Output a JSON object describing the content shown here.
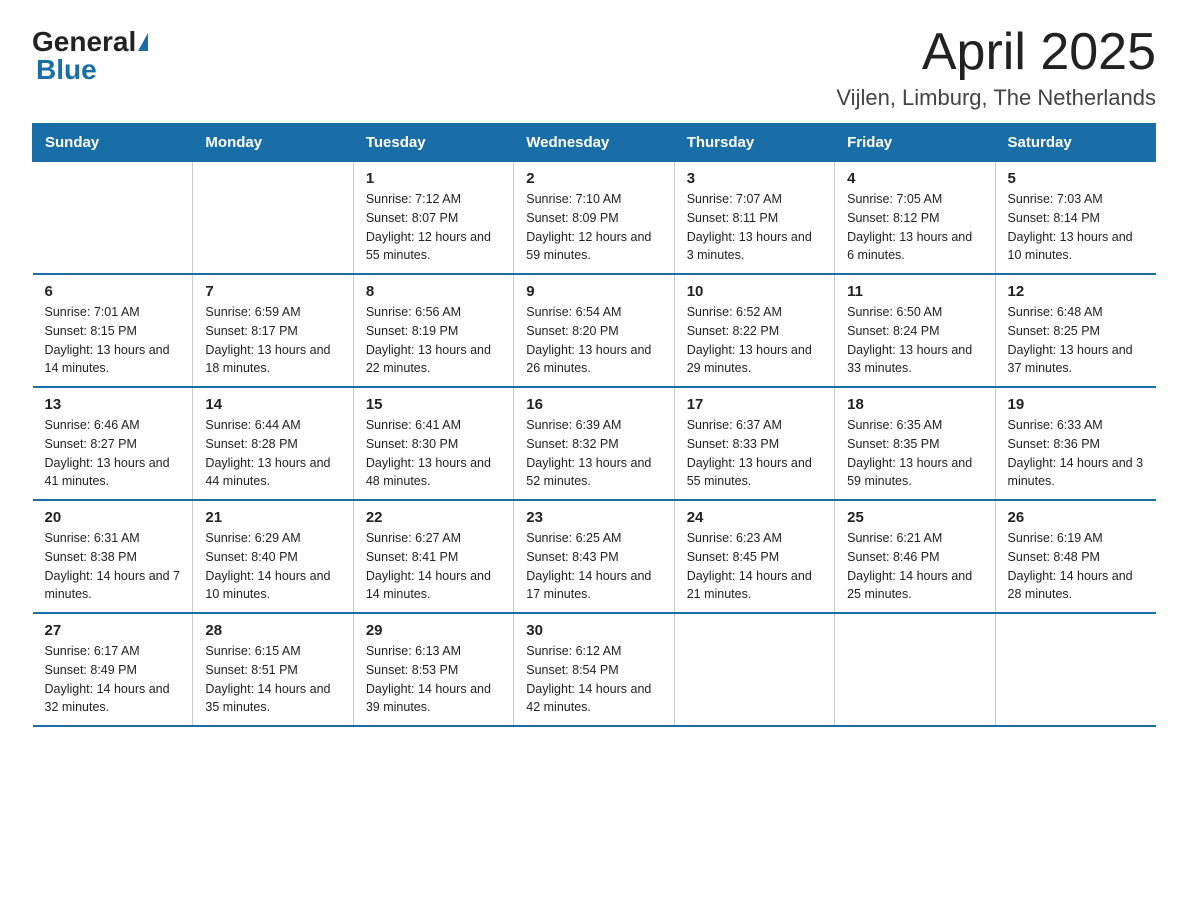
{
  "header": {
    "logo_general": "General",
    "logo_blue": "Blue",
    "title": "April 2025",
    "subtitle": "Vijlen, Limburg, The Netherlands"
  },
  "days_of_week": [
    "Sunday",
    "Monday",
    "Tuesday",
    "Wednesday",
    "Thursday",
    "Friday",
    "Saturday"
  ],
  "weeks": [
    [
      {
        "day": "",
        "sunrise": "",
        "sunset": "",
        "daylight": ""
      },
      {
        "day": "",
        "sunrise": "",
        "sunset": "",
        "daylight": ""
      },
      {
        "day": "1",
        "sunrise": "Sunrise: 7:12 AM",
        "sunset": "Sunset: 8:07 PM",
        "daylight": "Daylight: 12 hours and 55 minutes."
      },
      {
        "day": "2",
        "sunrise": "Sunrise: 7:10 AM",
        "sunset": "Sunset: 8:09 PM",
        "daylight": "Daylight: 12 hours and 59 minutes."
      },
      {
        "day": "3",
        "sunrise": "Sunrise: 7:07 AM",
        "sunset": "Sunset: 8:11 PM",
        "daylight": "Daylight: 13 hours and 3 minutes."
      },
      {
        "day": "4",
        "sunrise": "Sunrise: 7:05 AM",
        "sunset": "Sunset: 8:12 PM",
        "daylight": "Daylight: 13 hours and 6 minutes."
      },
      {
        "day": "5",
        "sunrise": "Sunrise: 7:03 AM",
        "sunset": "Sunset: 8:14 PM",
        "daylight": "Daylight: 13 hours and 10 minutes."
      }
    ],
    [
      {
        "day": "6",
        "sunrise": "Sunrise: 7:01 AM",
        "sunset": "Sunset: 8:15 PM",
        "daylight": "Daylight: 13 hours and 14 minutes."
      },
      {
        "day": "7",
        "sunrise": "Sunrise: 6:59 AM",
        "sunset": "Sunset: 8:17 PM",
        "daylight": "Daylight: 13 hours and 18 minutes."
      },
      {
        "day": "8",
        "sunrise": "Sunrise: 6:56 AM",
        "sunset": "Sunset: 8:19 PM",
        "daylight": "Daylight: 13 hours and 22 minutes."
      },
      {
        "day": "9",
        "sunrise": "Sunrise: 6:54 AM",
        "sunset": "Sunset: 8:20 PM",
        "daylight": "Daylight: 13 hours and 26 minutes."
      },
      {
        "day": "10",
        "sunrise": "Sunrise: 6:52 AM",
        "sunset": "Sunset: 8:22 PM",
        "daylight": "Daylight: 13 hours and 29 minutes."
      },
      {
        "day": "11",
        "sunrise": "Sunrise: 6:50 AM",
        "sunset": "Sunset: 8:24 PM",
        "daylight": "Daylight: 13 hours and 33 minutes."
      },
      {
        "day": "12",
        "sunrise": "Sunrise: 6:48 AM",
        "sunset": "Sunset: 8:25 PM",
        "daylight": "Daylight: 13 hours and 37 minutes."
      }
    ],
    [
      {
        "day": "13",
        "sunrise": "Sunrise: 6:46 AM",
        "sunset": "Sunset: 8:27 PM",
        "daylight": "Daylight: 13 hours and 41 minutes."
      },
      {
        "day": "14",
        "sunrise": "Sunrise: 6:44 AM",
        "sunset": "Sunset: 8:28 PM",
        "daylight": "Daylight: 13 hours and 44 minutes."
      },
      {
        "day": "15",
        "sunrise": "Sunrise: 6:41 AM",
        "sunset": "Sunset: 8:30 PM",
        "daylight": "Daylight: 13 hours and 48 minutes."
      },
      {
        "day": "16",
        "sunrise": "Sunrise: 6:39 AM",
        "sunset": "Sunset: 8:32 PM",
        "daylight": "Daylight: 13 hours and 52 minutes."
      },
      {
        "day": "17",
        "sunrise": "Sunrise: 6:37 AM",
        "sunset": "Sunset: 8:33 PM",
        "daylight": "Daylight: 13 hours and 55 minutes."
      },
      {
        "day": "18",
        "sunrise": "Sunrise: 6:35 AM",
        "sunset": "Sunset: 8:35 PM",
        "daylight": "Daylight: 13 hours and 59 minutes."
      },
      {
        "day": "19",
        "sunrise": "Sunrise: 6:33 AM",
        "sunset": "Sunset: 8:36 PM",
        "daylight": "Daylight: 14 hours and 3 minutes."
      }
    ],
    [
      {
        "day": "20",
        "sunrise": "Sunrise: 6:31 AM",
        "sunset": "Sunset: 8:38 PM",
        "daylight": "Daylight: 14 hours and 7 minutes."
      },
      {
        "day": "21",
        "sunrise": "Sunrise: 6:29 AM",
        "sunset": "Sunset: 8:40 PM",
        "daylight": "Daylight: 14 hours and 10 minutes."
      },
      {
        "day": "22",
        "sunrise": "Sunrise: 6:27 AM",
        "sunset": "Sunset: 8:41 PM",
        "daylight": "Daylight: 14 hours and 14 minutes."
      },
      {
        "day": "23",
        "sunrise": "Sunrise: 6:25 AM",
        "sunset": "Sunset: 8:43 PM",
        "daylight": "Daylight: 14 hours and 17 minutes."
      },
      {
        "day": "24",
        "sunrise": "Sunrise: 6:23 AM",
        "sunset": "Sunset: 8:45 PM",
        "daylight": "Daylight: 14 hours and 21 minutes."
      },
      {
        "day": "25",
        "sunrise": "Sunrise: 6:21 AM",
        "sunset": "Sunset: 8:46 PM",
        "daylight": "Daylight: 14 hours and 25 minutes."
      },
      {
        "day": "26",
        "sunrise": "Sunrise: 6:19 AM",
        "sunset": "Sunset: 8:48 PM",
        "daylight": "Daylight: 14 hours and 28 minutes."
      }
    ],
    [
      {
        "day": "27",
        "sunrise": "Sunrise: 6:17 AM",
        "sunset": "Sunset: 8:49 PM",
        "daylight": "Daylight: 14 hours and 32 minutes."
      },
      {
        "day": "28",
        "sunrise": "Sunrise: 6:15 AM",
        "sunset": "Sunset: 8:51 PM",
        "daylight": "Daylight: 14 hours and 35 minutes."
      },
      {
        "day": "29",
        "sunrise": "Sunrise: 6:13 AM",
        "sunset": "Sunset: 8:53 PM",
        "daylight": "Daylight: 14 hours and 39 minutes."
      },
      {
        "day": "30",
        "sunrise": "Sunrise: 6:12 AM",
        "sunset": "Sunset: 8:54 PM",
        "daylight": "Daylight: 14 hours and 42 minutes."
      },
      {
        "day": "",
        "sunrise": "",
        "sunset": "",
        "daylight": ""
      },
      {
        "day": "",
        "sunrise": "",
        "sunset": "",
        "daylight": ""
      },
      {
        "day": "",
        "sunrise": "",
        "sunset": "",
        "daylight": ""
      }
    ]
  ]
}
